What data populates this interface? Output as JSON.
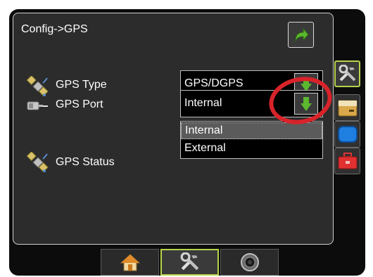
{
  "header": {
    "title": "Config->GPS"
  },
  "rows": [
    {
      "label": "GPS Type",
      "icon": "satellite-icon"
    },
    {
      "label": "GPS Port",
      "icon": "gps-receiver-icon"
    },
    {
      "label": "GPS Status",
      "icon": "satellite-icon"
    }
  ],
  "gps_type": {
    "value": "GPS/DGPS"
  },
  "gps_port": {
    "value": "Internal",
    "options": [
      "Internal",
      "External"
    ],
    "highlighted": "Internal"
  },
  "side_tabs": [
    "tools-icon",
    "memory-storage-icon",
    "monitor-icon",
    "toolbox-icon"
  ],
  "bottom_tabs": [
    "home-icon",
    "tools-icon",
    "camera-icon"
  ],
  "colors": {
    "accent": "#b7d34a",
    "arrow_green": "#5cb82e",
    "annotation_red": "#d8232a",
    "panel": "#2c2c2c",
    "frame": "#0c0c0c"
  }
}
